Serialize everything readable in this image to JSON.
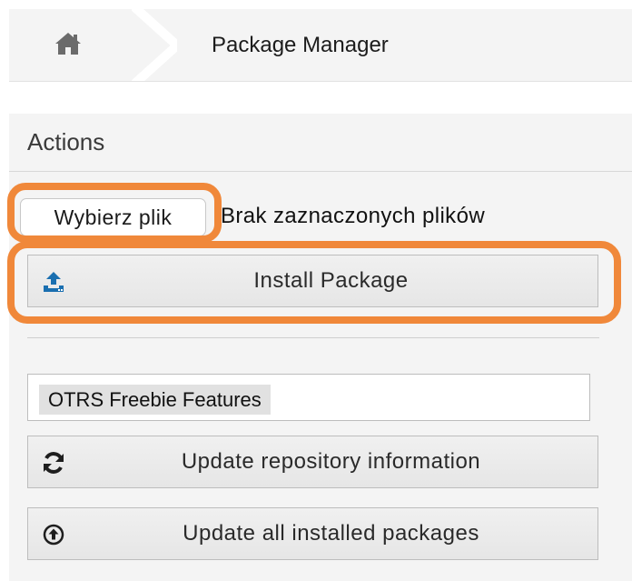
{
  "breadcrumb": {
    "home_icon": "home-icon",
    "current": "Package Manager"
  },
  "panel": {
    "title": "Actions",
    "file_input": {
      "button_label": "Wybierz plik",
      "status": "Brak zaznaczonych plików"
    },
    "install_button": {
      "icon": "upload-icon",
      "label": "Install Package"
    },
    "repository_select": {
      "value": "OTRS Freebie Features"
    },
    "update_repo_button": {
      "icon": "refresh-icon",
      "label": "Update repository information"
    },
    "update_all_button": {
      "icon": "circle-arrow-up-icon",
      "label": "Update all installed packages"
    }
  },
  "colors": {
    "highlight": "#f0883a",
    "icon_blue": "#1a6fb0",
    "panel_bg": "#f4f4f4"
  }
}
